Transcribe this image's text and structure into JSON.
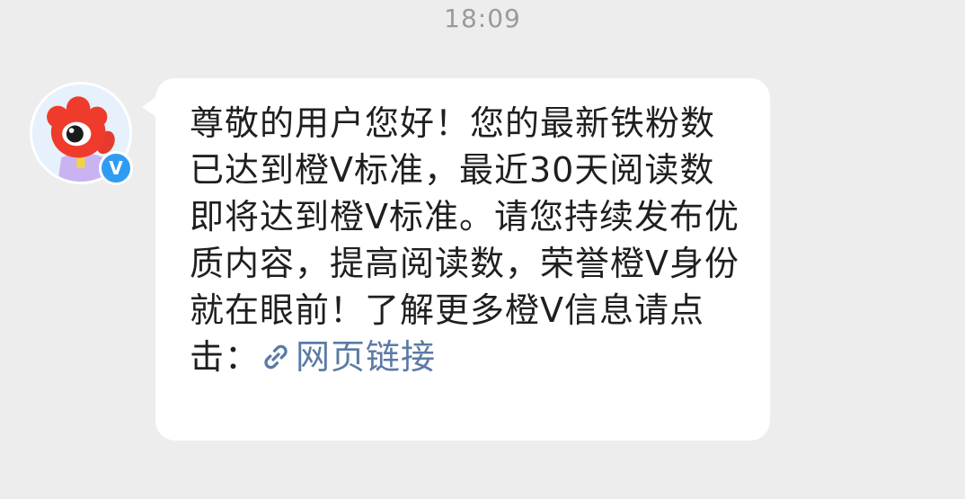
{
  "timestamp": "18:09",
  "sender": {
    "verified_badge": "V",
    "badge_color": "#2f9cf2"
  },
  "message": {
    "text": "尊敬的用户您好！您的最新铁粉数已达到橙V标准，最近30天阅读数即将达到橙V标准。请您持续发布优质内容，提高阅读数，荣誉橙V身份就在眼前！了解更多橙V信息请点击：",
    "link_label": "网页链接",
    "link_icon": "link-icon",
    "link_color": "#5b7aa5"
  }
}
